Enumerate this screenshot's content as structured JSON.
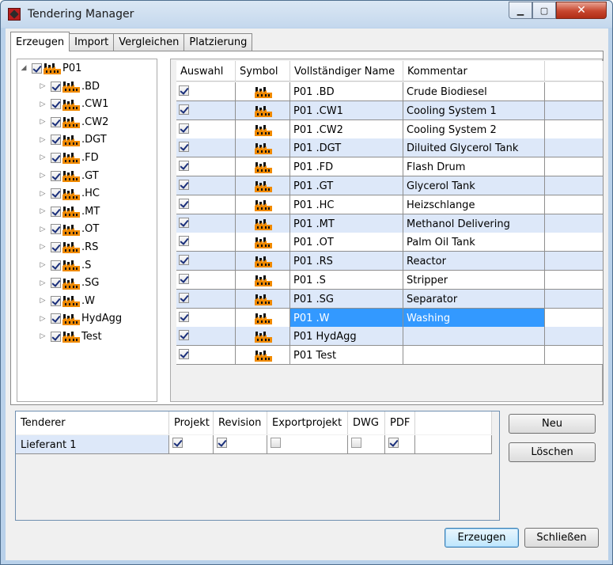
{
  "window": {
    "title": "Tendering Manager",
    "close_glyph": "✕",
    "minimize_glyph": "▁",
    "maximize_glyph": "▢"
  },
  "tabs": [
    {
      "label": "Erzeugen",
      "active": true
    },
    {
      "label": "Import",
      "active": false
    },
    {
      "label": "Vergleichen",
      "active": false
    },
    {
      "label": "Platzierung",
      "active": false
    }
  ],
  "tree": {
    "root": {
      "label": "P01",
      "expander": "◢",
      "checked": true
    },
    "children": [
      {
        "label": ".BD",
        "expander": "▷",
        "checked": true
      },
      {
        "label": ".CW1",
        "expander": "▷",
        "checked": true
      },
      {
        "label": ".CW2",
        "expander": "▷",
        "checked": true
      },
      {
        "label": ".DGT",
        "expander": "▷",
        "checked": true
      },
      {
        "label": ".FD",
        "expander": "▷",
        "checked": true
      },
      {
        "label": ".GT",
        "expander": "▷",
        "checked": true
      },
      {
        "label": ".HC",
        "expander": "▷",
        "checked": true
      },
      {
        "label": ".MT",
        "expander": "▷",
        "checked": true
      },
      {
        "label": ".OT",
        "expander": "▷",
        "checked": true
      },
      {
        "label": ".RS",
        "expander": "▷",
        "checked": true
      },
      {
        "label": ".S",
        "expander": "▷",
        "checked": true
      },
      {
        "label": ".SG",
        "expander": "▷",
        "checked": true
      },
      {
        "label": ".W",
        "expander": "▷",
        "checked": true
      },
      {
        "label": "HydAgg",
        "expander": "▷",
        "checked": true
      },
      {
        "label": "Test",
        "expander": "▷",
        "checked": true
      }
    ]
  },
  "grid": {
    "columns": [
      "Auswahl",
      "Symbol",
      "Vollständiger Name",
      "Kommentar",
      ""
    ],
    "rows": [
      {
        "checked": true,
        "name": "P01 .BD",
        "comment": "Crude Biodiesel"
      },
      {
        "checked": true,
        "name": "P01 .CW1",
        "comment": "Cooling System 1"
      },
      {
        "checked": true,
        "name": "P01 .CW2",
        "comment": "Cooling System 2"
      },
      {
        "checked": true,
        "name": "P01 .DGT",
        "comment": "Diluited Glycerol Tank"
      },
      {
        "checked": true,
        "name": "P01 .FD",
        "comment": "Flash Drum"
      },
      {
        "checked": true,
        "name": "P01 .GT",
        "comment": "Glycerol Tank"
      },
      {
        "checked": true,
        "name": "P01 .HC",
        "comment": "Heizschlange"
      },
      {
        "checked": true,
        "name": "P01 .MT",
        "comment": "Methanol Delivering"
      },
      {
        "checked": true,
        "name": "P01 .OT",
        "comment": "Palm Oil Tank"
      },
      {
        "checked": true,
        "name": "P01 .RS",
        "comment": "Reactor"
      },
      {
        "checked": true,
        "name": "P01 .S",
        "comment": "Stripper"
      },
      {
        "checked": true,
        "name": "P01 .SG",
        "comment": "Separator"
      },
      {
        "checked": true,
        "name": "P01 .W",
        "comment": "Washing",
        "selected": true
      },
      {
        "checked": true,
        "name": "P01 HydAgg",
        "comment": ""
      },
      {
        "checked": true,
        "name": "P01 Test",
        "comment": ""
      }
    ]
  },
  "tenderer": {
    "columns": [
      "Tenderer",
      "Projekt",
      "Revision",
      "Exportprojekt",
      "DWG",
      "PDF",
      ""
    ],
    "rows": [
      {
        "name": "Lieferant 1",
        "projekt": true,
        "revision": true,
        "exportprojekt": false,
        "dwg": false,
        "pdf": true
      }
    ]
  },
  "buttons": {
    "neu": "Neu",
    "loeschen": "Löschen",
    "erzeugen": "Erzeugen",
    "schliessen": "Schließen"
  },
  "colors": {
    "selection": "#3399ff",
    "alt_row": "#dde8f9",
    "facility_orange": "#f08a00"
  },
  "icons": {
    "tree_node": "facility-icon",
    "grid_symbol": "facility-icon",
    "app": "app-icon"
  }
}
